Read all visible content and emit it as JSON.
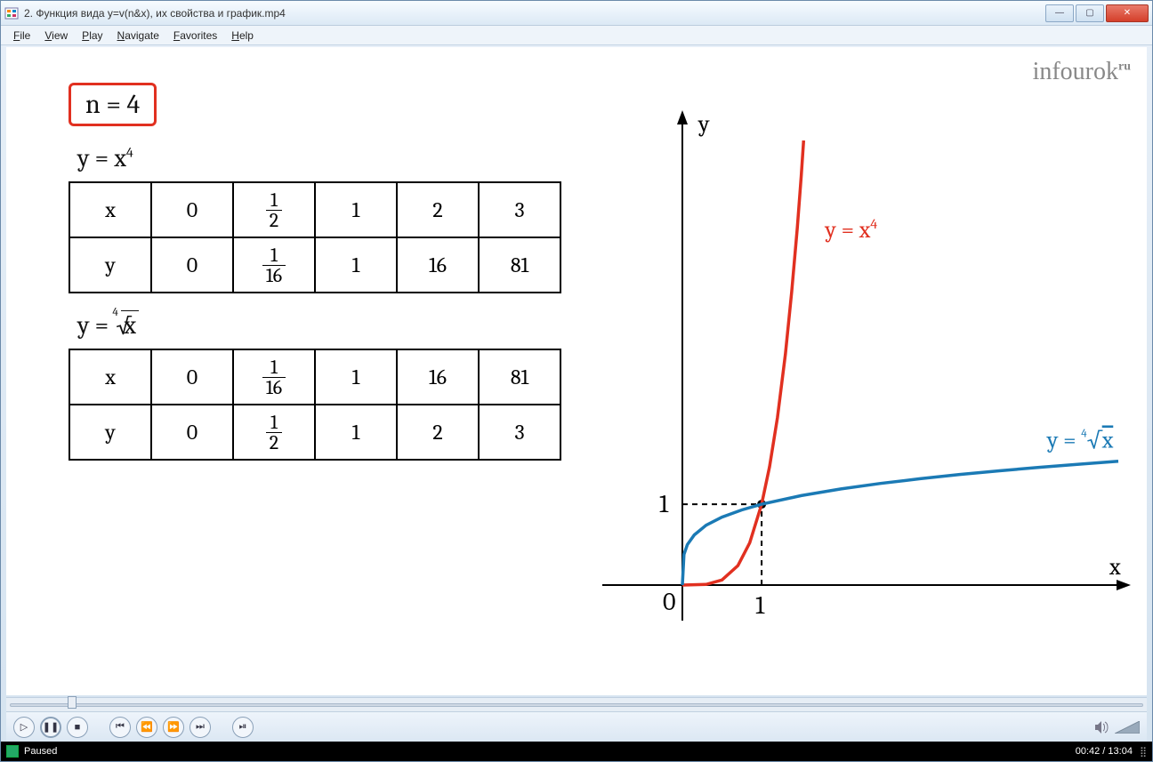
{
  "window": {
    "title": "2. Функция вида y=v(n&x), их свойства и график.mp4"
  },
  "menu": {
    "file": "File",
    "view": "View",
    "play": "Play",
    "navigate": "Navigate",
    "favorites": "Favorites",
    "help": "Help"
  },
  "logo": {
    "brand": "infourok",
    "tld": "ru"
  },
  "content": {
    "n_value": "n = 4",
    "eq1": "y = x",
    "eq1_exp": "4",
    "table1": {
      "row_x_label": "x",
      "row_y_label": "y",
      "x": [
        "0",
        "1/2",
        "1",
        "2",
        "3"
      ],
      "y": [
        "0",
        "1/16",
        "1",
        "16",
        "81"
      ]
    },
    "eq2_lhs": "y = ",
    "eq2_root_index": "4",
    "eq2_radicand": "x",
    "table2": {
      "row_x_label": "x",
      "row_y_label": "y",
      "x": [
        "0",
        "1/16",
        "1",
        "16",
        "81"
      ],
      "y": [
        "0",
        "1/2",
        "1",
        "2",
        "3"
      ]
    }
  },
  "chart_data": {
    "type": "line",
    "title": "",
    "xlabel": "x",
    "ylabel": "y",
    "xlim": [
      0,
      5.5
    ],
    "ylim": [
      0,
      5.5
    ],
    "origin_label": "0",
    "ticks": {
      "x": [
        1
      ],
      "y": [
        1
      ]
    },
    "intersection": {
      "x": 1,
      "y": 1
    },
    "series": [
      {
        "name": "y = x⁴",
        "color": "#e13020",
        "label_pos": {
          "x": 1.8,
          "y": 4.3
        },
        "points": [
          {
            "x": 0,
            "y": 0
          },
          {
            "x": 0.3,
            "y": 0.0081
          },
          {
            "x": 0.5,
            "y": 0.0625
          },
          {
            "x": 0.7,
            "y": 0.2401
          },
          {
            "x": 0.85,
            "y": 0.522
          },
          {
            "x": 1,
            "y": 1
          },
          {
            "x": 1.1,
            "y": 1.4641
          },
          {
            "x": 1.2,
            "y": 2.0736
          },
          {
            "x": 1.3,
            "y": 2.8561
          },
          {
            "x": 1.38,
            "y": 3.63
          },
          {
            "x": 1.45,
            "y": 4.42
          },
          {
            "x": 1.5,
            "y": 5.06
          },
          {
            "x": 1.53,
            "y": 5.5
          }
        ]
      },
      {
        "name": "y = ⁴√x",
        "color": "#1b7ab5",
        "label_pos": {
          "x": 4.6,
          "y": 1.7
        },
        "points": [
          {
            "x": 0,
            "y": 0
          },
          {
            "x": 0.02,
            "y": 0.38
          },
          {
            "x": 0.0625,
            "y": 0.5
          },
          {
            "x": 0.15,
            "y": 0.62
          },
          {
            "x": 0.3,
            "y": 0.74
          },
          {
            "x": 0.5,
            "y": 0.84
          },
          {
            "x": 0.75,
            "y": 0.93
          },
          {
            "x": 1,
            "y": 1
          },
          {
            "x": 1.5,
            "y": 1.107
          },
          {
            "x": 2,
            "y": 1.189
          },
          {
            "x": 2.5,
            "y": 1.257
          },
          {
            "x": 3,
            "y": 1.316
          },
          {
            "x": 3.5,
            "y": 1.368
          },
          {
            "x": 4,
            "y": 1.414
          },
          {
            "x": 4.5,
            "y": 1.456
          },
          {
            "x": 5,
            "y": 1.495
          },
          {
            "x": 5.5,
            "y": 1.531
          }
        ]
      }
    ]
  },
  "playback": {
    "position_pct": 5.4,
    "current": "00:42",
    "total": "13:04",
    "separator": " / ",
    "status": "Paused"
  }
}
